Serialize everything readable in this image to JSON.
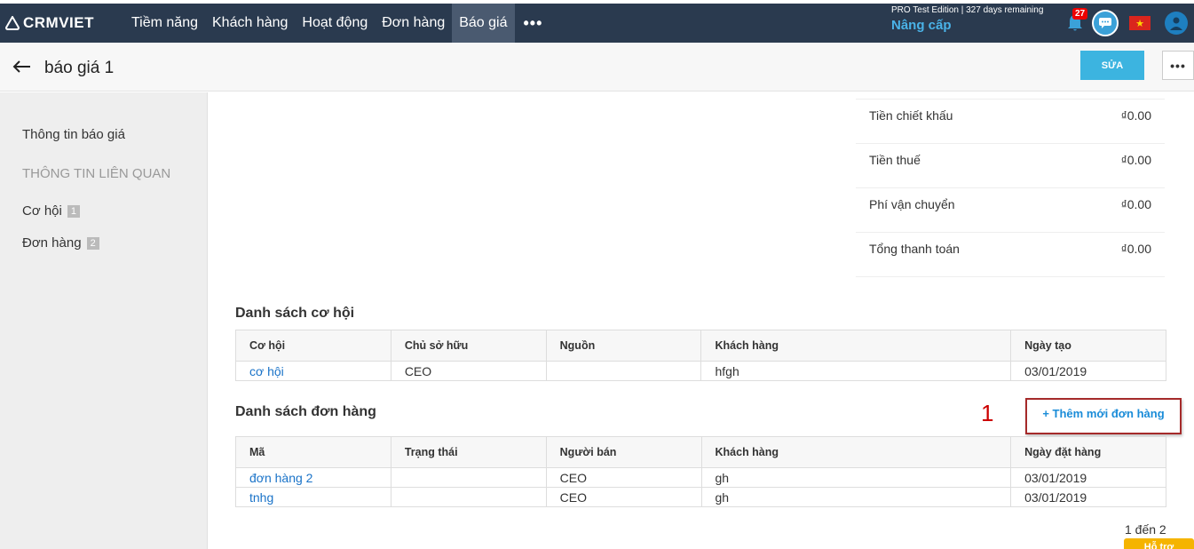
{
  "brand": {
    "name": "CRMVIET"
  },
  "nav": {
    "items": [
      "Tiềm năng",
      "Khách hàng",
      "Hoạt động",
      "Đơn hàng",
      "Báo giá"
    ],
    "active_index": 4,
    "more_label": "•••"
  },
  "edition": {
    "note": "PRO Test Edition | 327 days remaining",
    "upgrade_label": "Nâng cấp"
  },
  "notifications": {
    "count": "27"
  },
  "title_bar": {
    "title": "báo giá 1",
    "edit_label": "SỬA",
    "more_label": "•••"
  },
  "sidebar": {
    "info_link": "Thông tin báo giá",
    "related_heading": "THÔNG TIN LIÊN QUAN",
    "items": [
      {
        "label": "Cơ hội",
        "count": "1"
      },
      {
        "label": "Đơn hàng",
        "count": "2"
      }
    ]
  },
  "summary": [
    {
      "label": "Tiền chiết khấu",
      "value": "₫0.00"
    },
    {
      "label": "Tiền thuế",
      "value": "₫0.00"
    },
    {
      "label": "Phí vận chuyển",
      "value": "₫0.00"
    },
    {
      "label": "Tổng thanh toán",
      "value": "₫0.00"
    }
  ],
  "opportunities": {
    "title": "Danh sách cơ hội",
    "columns": [
      "Cơ hội",
      "Chủ sở hữu",
      "Nguồn",
      "Khách hàng",
      "Ngày tạo"
    ],
    "rows": [
      [
        "cơ hội",
        "CEO",
        "",
        "hfgh",
        "03/01/2019"
      ]
    ]
  },
  "orders": {
    "title": "Danh sách đơn hàng",
    "add_label": "+ Thêm mới đơn hàng",
    "annotation_number": "1",
    "columns": [
      "Mã",
      "Trạng thái",
      "Người bán",
      "Khách hàng",
      "Ngày đặt hàng"
    ],
    "rows": [
      [
        "đơn hàng 2",
        "",
        "CEO",
        "gh",
        "03/01/2019"
      ],
      [
        "tnhg",
        "",
        "CEO",
        "gh",
        "03/01/2019"
      ]
    ],
    "pager": "1 đến 2"
  },
  "support": {
    "label": "Hỗ trợ"
  },
  "colors": {
    "topbar": "#2a3a4f",
    "accent": "#3cb4e0",
    "link": "#1a73c8",
    "highlight_border": "#a52a2a"
  }
}
